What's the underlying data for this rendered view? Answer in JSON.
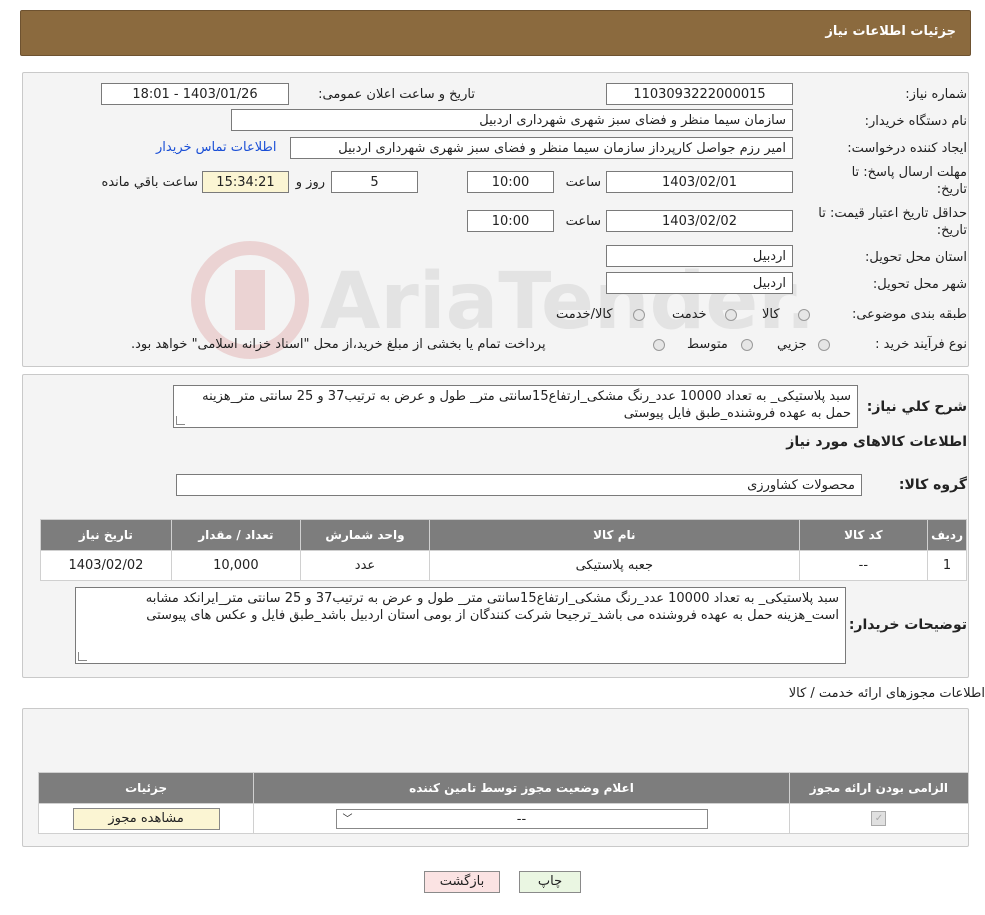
{
  "header": {
    "title": "جزئیات اطلاعات نیاز"
  },
  "form": {
    "need_number_label": "شماره نیاز:",
    "need_number": "1103093222000015",
    "announce_label": "تاریخ و ساعت اعلان عمومی:",
    "announce_value": "1403/01/26 - 18:01",
    "buyer_org_label": "نام دستگاه خریدار:",
    "buyer_org": "سازمان سیما منظر و فضای سبز شهری شهرداری اردبیل",
    "creator_label": "ایجاد کننده درخواست:",
    "creator": "امیر رزم جواصل کارپرداز سازمان سیما منظر و فضای سبز شهری شهرداری اردبیل",
    "contact_link": "اطلاعات تماس خریدار",
    "deadline_label_1": "مهلت ارسال پاسخ: تا",
    "deadline_label_2": "تاریخ:",
    "deadline_date": "1403/02/01",
    "hour_label": "ساعت",
    "deadline_time": "10:00",
    "days_value": "5",
    "days_label": "روز و",
    "remaining_time": "15:34:21",
    "remaining_label": "ساعت باقي مانده",
    "validity_label_1": "حداقل تاریخ اعتبار قیمت: تا",
    "validity_label_2": "تاریخ:",
    "validity_date": "1403/02/02",
    "validity_time": "10:00",
    "province_label": "استان محل تحویل:",
    "province": "اردبیل",
    "city_label": "شهر محل تحویل:",
    "city": "اردبیل",
    "category_label": "طبقه بندی موضوعی:",
    "category_options": [
      "کالا",
      "خدمت",
      "کالا/خدمت"
    ],
    "process_label": "نوع فرآیند خرید :",
    "process_options": [
      "جزیي",
      "متوسط"
    ],
    "process_note": "پرداخت تمام یا بخشی از مبلغ خرید،از محل \"اسناد خزانه اسلامی\" خواهد بود."
  },
  "summary": {
    "desc_label": "شرح کلي نیاز:",
    "desc_text": "سبد پلاستیکی_ به تعداد 10000 عدد_رنگ مشکی_ارتفاع15سانتی متر_ طول و عرض به ترتیب37 و 25 سانتی متر_هزینه حمل به عهده فروشنده_طبق فایل پیوستی",
    "goods_info_title": "اطلاعات کالاهای مورد نیاز",
    "group_label": "گروه کالا:",
    "group_value": "محصولات کشاورزی"
  },
  "goods_table": {
    "headers": [
      "ردیف",
      "کد کالا",
      "نام کالا",
      "واحد شمارش",
      "تعداد / مقدار",
      "تاریخ نیاز"
    ],
    "rows": [
      [
        "1",
        "--",
        "جعبه پلاستیکی",
        "عدد",
        "10,000",
        "1403/02/02"
      ]
    ]
  },
  "buyer_notes": {
    "label": "توضیحات خریدار:",
    "text": "سبد پلاستیکی_ به تعداد 10000 عدد_رنگ مشکی_ارتفاع15سانتی متر_ طول و عرض به ترتیب37 و 25 سانتی متر_ایرانکد مشابه است_هزینه حمل به عهده فروشنده می باشد_ترجیحا شرکت کنندگان از بومی استان اردبیل باشد_طبق فایل و عکس های پیوستی"
  },
  "permits": {
    "section_title": "اطلاعات مجوزهای ارائه خدمت / کالا",
    "headers": [
      "الزامی بودن ارائه مجوز",
      "اعلام وضعیت مجوز توسط تامین کننده",
      "جزئیات"
    ],
    "select_value": "--",
    "view_button": "مشاهده مجوز"
  },
  "buttons": {
    "print": "چاپ",
    "back": "بازگشت"
  },
  "watermark": {
    "text": "AriaTender.neT"
  }
}
